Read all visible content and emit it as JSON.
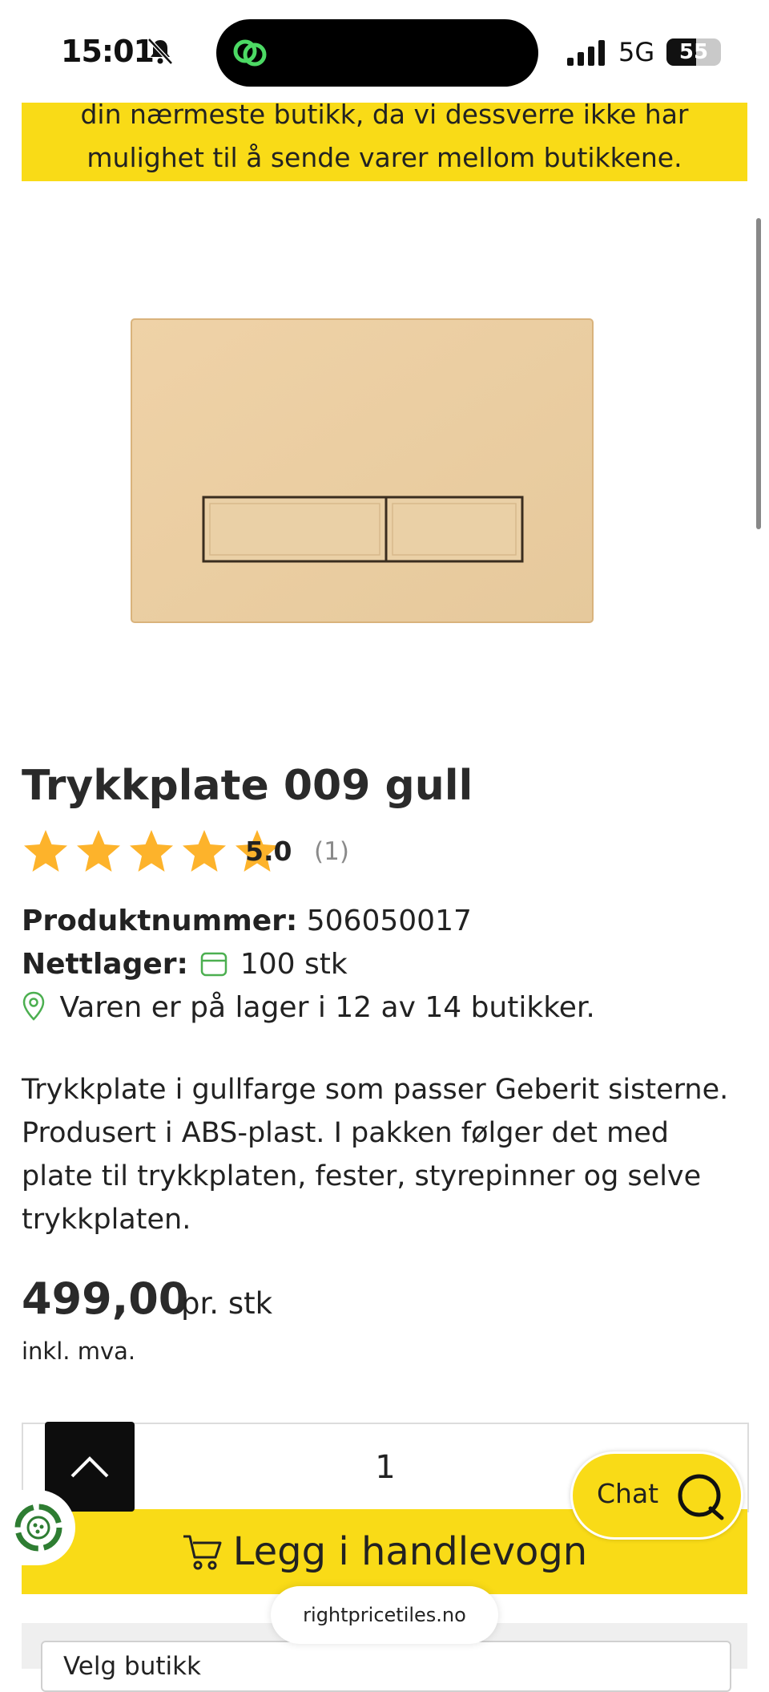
{
  "status_bar": {
    "time": "15:01",
    "network": "5G",
    "battery_level": 55,
    "battery_text": "55"
  },
  "notice": {
    "lines": [
      "din nærmeste butikk, da vi dessverre ikke har",
      "mulighet til å sende varer mellom butikkene."
    ]
  },
  "product": {
    "title": "Trykkplate 009 gull",
    "rating": {
      "stars": 5,
      "score": "5.0",
      "count": "(1)"
    },
    "product_number_label": "Produktnummer:",
    "product_number": "506050017",
    "stock_label": "Nettlager:",
    "stock_value": "100 stk",
    "store_availability": "Varen er på lager i 12 av 14 butikker.",
    "description": "Trykkplate i gullfarge som passer Geberit sisterne. Produsert i ABS-plast. I pakken følger det med plate til trykkplaten, fester, styrepinner og selve trykkplaten.",
    "price": "499,00",
    "price_unit": "pr. stk",
    "vat_note": "inkl. mva."
  },
  "cart": {
    "quantity": "1",
    "add_label": "Legg i handlevogn"
  },
  "chat": {
    "label": "Chat"
  },
  "browser": {
    "url": "rightpricetiles.no"
  },
  "store_select": {
    "partial_text": "Velg butikk"
  },
  "colors": {
    "accent": "#f9db17",
    "text": "#222222",
    "star": "#fdb32b",
    "location": "#4caf50"
  },
  "icons": [
    "bell-slash-icon",
    "app-logo-icon",
    "signal-icon",
    "battery-icon",
    "star-icon",
    "box-icon",
    "location-pin-icon",
    "cart-icon",
    "chevron-up-icon",
    "chat-bubble-icon",
    "recycle-icon"
  ]
}
